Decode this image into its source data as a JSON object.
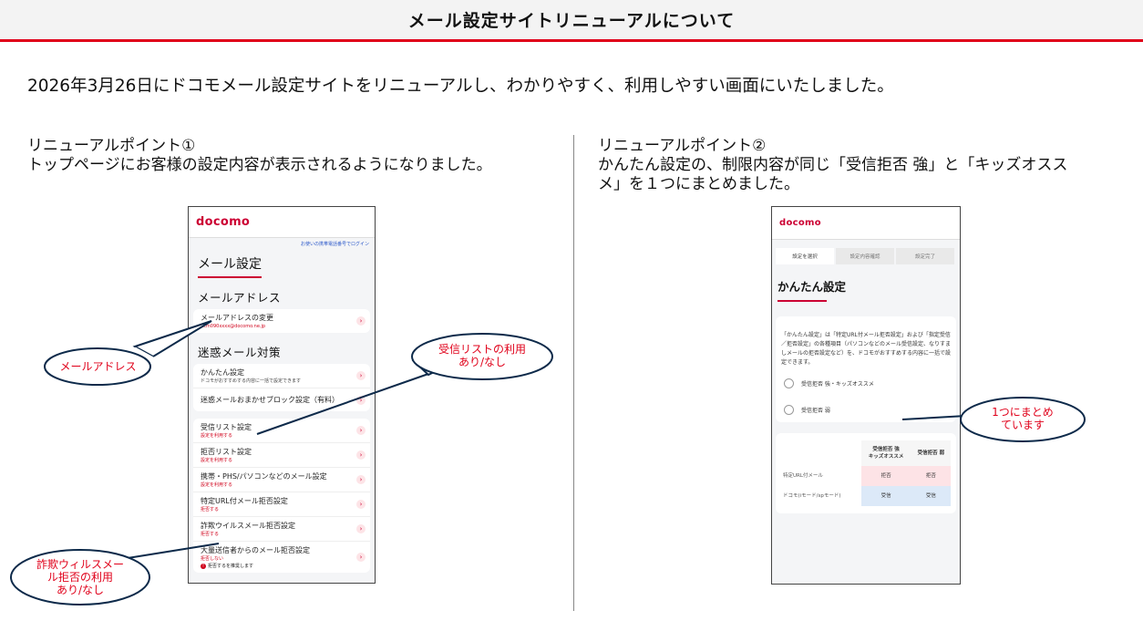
{
  "header": {
    "title": "メール設定サイトリニューアルについて"
  },
  "intro": "2026年3月26日にドコモメール設定サイトをリニューアルし、わかりやすく、利用しやすい画面にいたしました。",
  "points": [
    {
      "title": "リニューアルポイント①",
      "desc": "トップページにお客様の設定内容が表示されるようになりました。"
    },
    {
      "title": "リニューアルポイント②",
      "desc_line1": "かんたん設定の、制限内容が同じ「受信拒否 強」と「キッズオスス",
      "desc_line2": "メ」を１つにまとめました。"
    }
  ],
  "screen1": {
    "logo": "docomo",
    "login_link": "お使いの携帯電話番号でログイン",
    "page_title": "メール設定",
    "address_section": "メールアドレス",
    "address_row": {
      "label": "メールアドレスの変更",
      "sub": "dcm090xxxx@docomo.ne.jp"
    },
    "spam_section": "迷惑メール対策",
    "spam_rows": [
      {
        "label": "かんたん設定",
        "sub": "ドコモがおすすめする内容に一括で設定できます"
      },
      {
        "label": "迷惑メールおまかせブロック設定（有料）",
        "sub": ""
      }
    ],
    "list_rows": [
      {
        "label": "受信リスト設定",
        "sub": "設定を利用する"
      },
      {
        "label": "拒否リスト設定",
        "sub": "設定を利用する"
      },
      {
        "label": "携帯・PHS/パソコンなどのメール設定",
        "sub": "設定を利用する"
      },
      {
        "label": "特定URL付メール拒否設定",
        "sub": "拒否する"
      },
      {
        "label": "詐欺ウイルスメール拒否設定",
        "sub": "拒否する"
      },
      {
        "label": "大量送信者からのメール拒否設定",
        "sub": "拒否しない"
      }
    ],
    "warning": "拒否するを推奨します",
    "chevron": "›"
  },
  "screen2": {
    "logo": "docomo",
    "steps": [
      "設定を選択",
      "設定内容確認",
      "設定完了"
    ],
    "title": "かんたん設定",
    "description": "「かんたん設定」は「特定URL付メール拒否設定」および「指定受信／拒否設定」の各種項目（パソコンなどのメール受信設定、なりすましメールの拒否設定など）を、ドコモがおすすめする内容に一括で設定できます。",
    "options": [
      "受信拒否 強・キッズオススメ",
      "受信拒否 弱"
    ],
    "table": {
      "col1": "受信拒否 強",
      "col1b": "キッズオススメ",
      "col2": "受信拒否 弱",
      "rows": [
        {
          "label": "特定URL付メール",
          "v1": "拒否",
          "v2": "拒否"
        },
        {
          "label": "ドコモ(iモード/spモード)",
          "v1": "受信",
          "v2": "受信"
        }
      ]
    }
  },
  "callouts": {
    "mail_address": "メールアドレス",
    "receive_list_1": "受信リストの利用",
    "receive_list_2": "あり/なし",
    "fraud_1": "詐欺ウィルスメー",
    "fraud_2": "ル拒否の利用",
    "fraud_3": "あり/なし",
    "merged_1": "1つにまとめ",
    "merged_2": "ています"
  },
  "colors": {
    "accent": "#e0001a",
    "brand": "#cc0033",
    "callout_border": "#0d2a4a"
  }
}
